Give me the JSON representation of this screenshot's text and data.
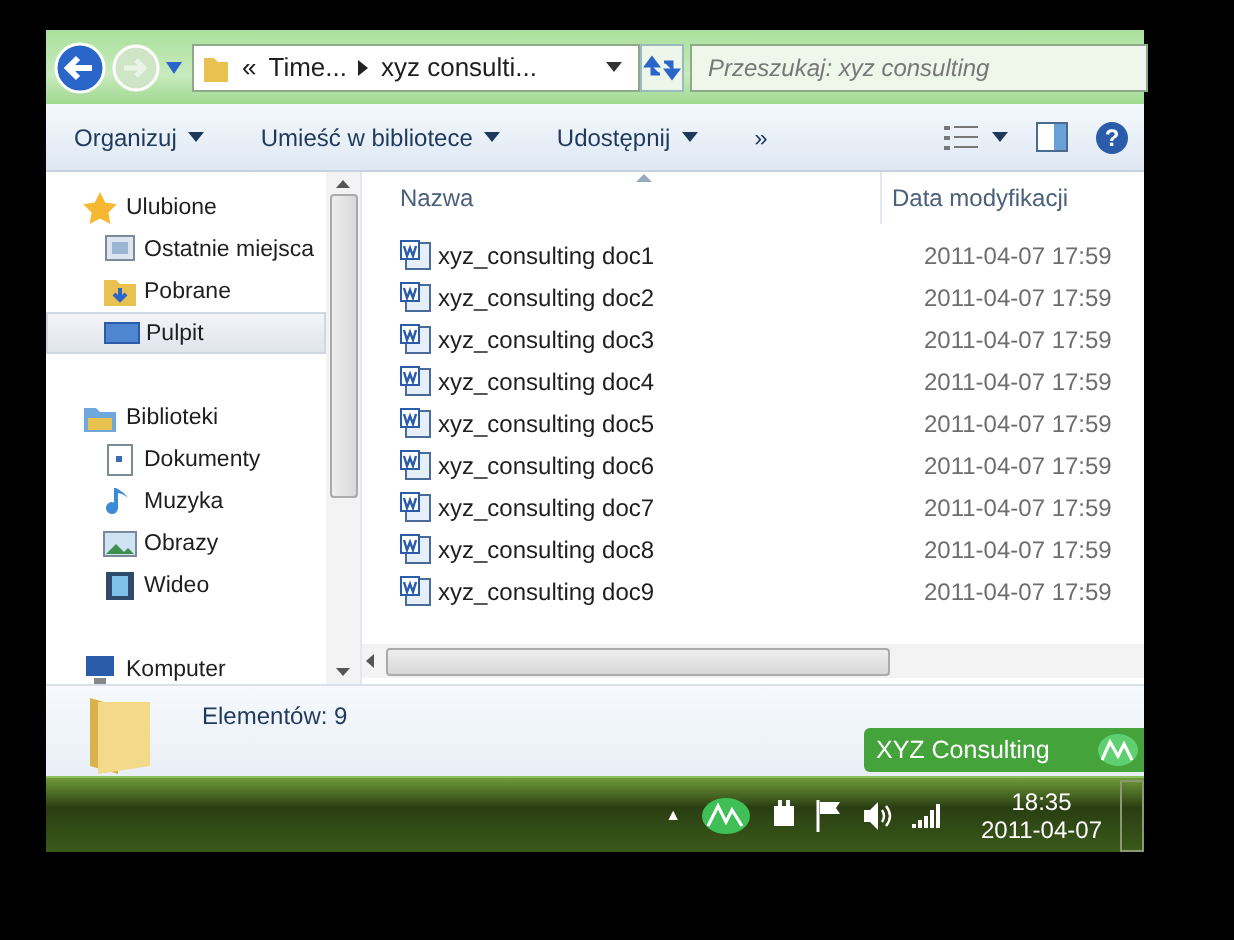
{
  "address_bar": {
    "prefix": "«",
    "segments": [
      "Time...",
      "xyz consulti..."
    ]
  },
  "search": {
    "placeholder": "Przeszukaj: xyz consulting"
  },
  "toolbar": {
    "buttons": [
      {
        "label": "Organizuj",
        "dropdown": true
      },
      {
        "label": "Umieść w bibliotece",
        "dropdown": true
      },
      {
        "label": "Udostępnij",
        "dropdown": true
      },
      {
        "label": "»",
        "dropdown": false
      }
    ],
    "help_label": "?"
  },
  "sidebar": {
    "items": [
      {
        "label": "Ulubione",
        "kind": "star",
        "selected": false,
        "children": [
          {
            "label": "Ostatnie miejsca",
            "kind": "recent",
            "selected": false
          },
          {
            "label": "Pobrane",
            "kind": "download",
            "selected": false
          },
          {
            "label": "Pulpit",
            "kind": "desktop",
            "selected": true
          }
        ]
      },
      {
        "label": "Biblioteki",
        "kind": "library",
        "selected": false,
        "children": [
          {
            "label": "Dokumenty",
            "kind": "document",
            "selected": false
          },
          {
            "label": "Muzyka",
            "kind": "music",
            "selected": false
          },
          {
            "label": "Obrazy",
            "kind": "picture",
            "selected": false
          },
          {
            "label": "Wideo",
            "kind": "video",
            "selected": false
          }
        ]
      },
      {
        "label": "Komputer",
        "kind": "computer",
        "selected": false
      }
    ]
  },
  "table": {
    "columns": [
      "Nazwa",
      "Data modyfikacji"
    ],
    "rows": [
      {
        "name": "xyz_consulting doc1",
        "modified": "2011-04-07 17:59",
        "selected": false
      },
      {
        "name": "xyz_consulting doc2",
        "modified": "2011-04-07 17:59",
        "selected": false
      },
      {
        "name": "xyz_consulting doc3",
        "modified": "2011-04-07 17:59",
        "selected": false
      },
      {
        "name": "xyz_consulting doc4",
        "modified": "2011-04-07 17:59",
        "selected": false
      },
      {
        "name": "xyz_consulting doc5",
        "modified": "2011-04-07 17:59",
        "selected": false
      },
      {
        "name": "xyz_consulting doc6",
        "modified": "2011-04-07 17:59",
        "selected": false
      },
      {
        "name": "xyz_consulting doc7",
        "modified": "2011-04-07 17:59",
        "selected": false
      },
      {
        "name": "xyz_consulting doc8",
        "modified": "2011-04-07 17:59",
        "selected": false
      },
      {
        "name": "xyz_consulting doc9",
        "modified": "2011-04-07 17:59",
        "selected": false
      }
    ]
  },
  "status_bar": {
    "item_count": "Elementów: 9",
    "badge": "XYZ Consulting"
  },
  "taskbar": {
    "tray_toggle": "▲",
    "time": "18:35",
    "date": "2011-04-07"
  }
}
